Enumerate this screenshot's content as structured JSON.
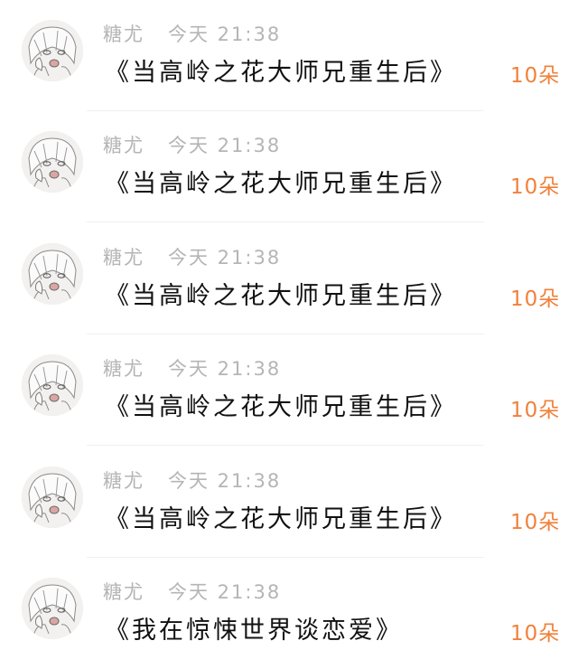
{
  "feed": {
    "items": [
      {
        "user": "糖尤",
        "time": "今天 21:38",
        "title": "《当高岭之花大师兄重生后》",
        "count": "10朵"
      },
      {
        "user": "糖尤",
        "time": "今天 21:38",
        "title": "《当高岭之花大师兄重生后》",
        "count": "10朵"
      },
      {
        "user": "糖尤",
        "time": "今天 21:38",
        "title": "《当高岭之花大师兄重生后》",
        "count": "10朵"
      },
      {
        "user": "糖尤",
        "time": "今天 21:38",
        "title": "《当高岭之花大师兄重生后》",
        "count": "10朵"
      },
      {
        "user": "糖尤",
        "time": "今天 21:38",
        "title": "《当高岭之花大师兄重生后》",
        "count": "10朵"
      },
      {
        "user": "糖尤",
        "time": "今天 21:38",
        "title": "《我在惊悚世界谈恋爱》",
        "count": "10朵"
      }
    ]
  }
}
